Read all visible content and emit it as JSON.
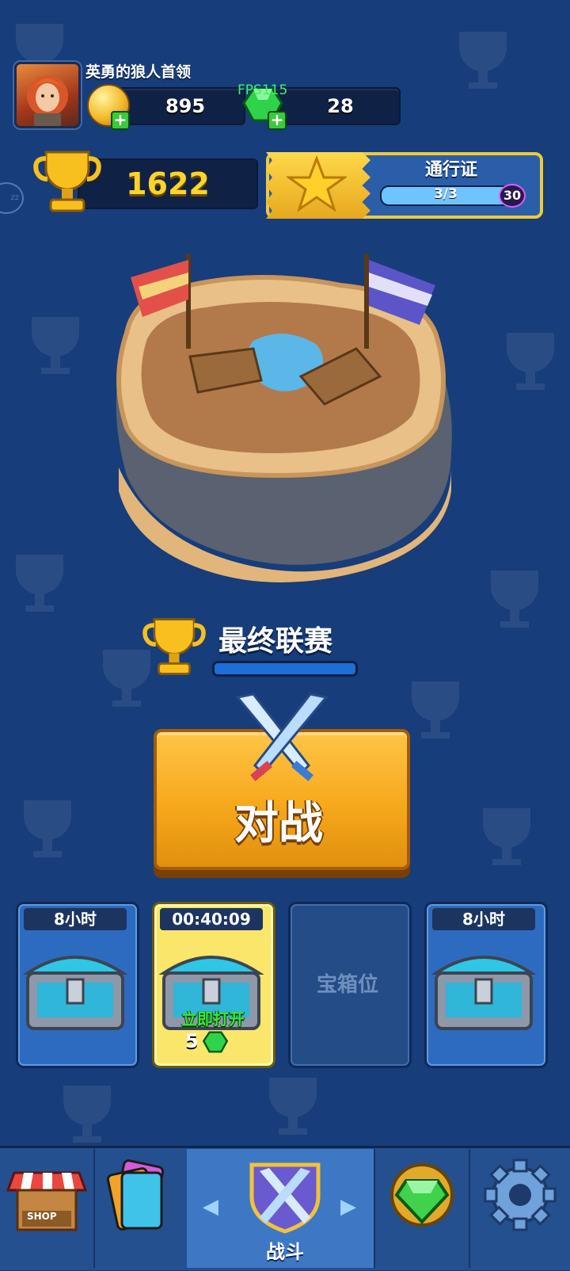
{
  "player": {
    "name": "英勇的狼人首领",
    "coins": "895",
    "gems": "28",
    "fps": "FPS115"
  },
  "trophies": {
    "count": "1622"
  },
  "pass": {
    "title": "通行证",
    "progress": "3/3",
    "progress_fraction": 1.0,
    "level": "30"
  },
  "league": {
    "name": "最终联赛",
    "progress_fraction": 1.0
  },
  "battle": {
    "label": "对战"
  },
  "chests": [
    {
      "timer": "8小时",
      "state": "locked"
    },
    {
      "timer": "00:40:09",
      "state": "unlocking",
      "open_label": "立即打开",
      "open_cost": "5"
    },
    {
      "empty_label": "宝箱位",
      "state": "empty"
    },
    {
      "timer": "8小时",
      "state": "locked"
    }
  ],
  "nav": {
    "shop_text": "SHOP",
    "battle_label": "战斗",
    "items": [
      "shop",
      "cards",
      "battle",
      "gems",
      "settings"
    ]
  },
  "colors": {
    "background": "#173d7a",
    "battle_button": "#f6a81c",
    "trophy_text": "#ffd428",
    "fps_text": "#3ef066"
  }
}
